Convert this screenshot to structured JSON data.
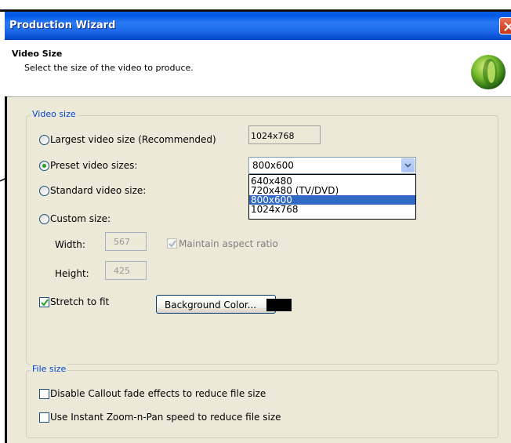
{
  "window": {
    "title": "Production Wizard",
    "accent": "#0058e6"
  },
  "header": {
    "title": "Video Size",
    "subtitle": "Select the size of the video to produce."
  },
  "video_size": {
    "legend": "Video size",
    "largest_label": "Largest video size (Recommended)",
    "largest_value": "1024x768",
    "preset_label": "Preset video sizes:",
    "preset_selected": "800x600",
    "preset_options": [
      "640x480",
      "720x480 (TV/DVD)",
      "800x600",
      "1024x768"
    ],
    "standard_label": "Standard video size:",
    "custom_label": "Custom size:",
    "width_label": "Width:",
    "width_value": "567",
    "height_label": "Height:",
    "height_value": "425",
    "maintain_aspect_label": "Maintain aspect ratio",
    "stretch_label": "Stretch to fit",
    "stretch_checked": true,
    "background_button_label": "Background Color...",
    "background_color": "#000000"
  },
  "file_size": {
    "legend": "File size",
    "disable_fade_label": "Disable Callout fade effects to reduce file size",
    "instant_zoom_label": "Use Instant Zoom-n-Pan speed to reduce file size"
  }
}
